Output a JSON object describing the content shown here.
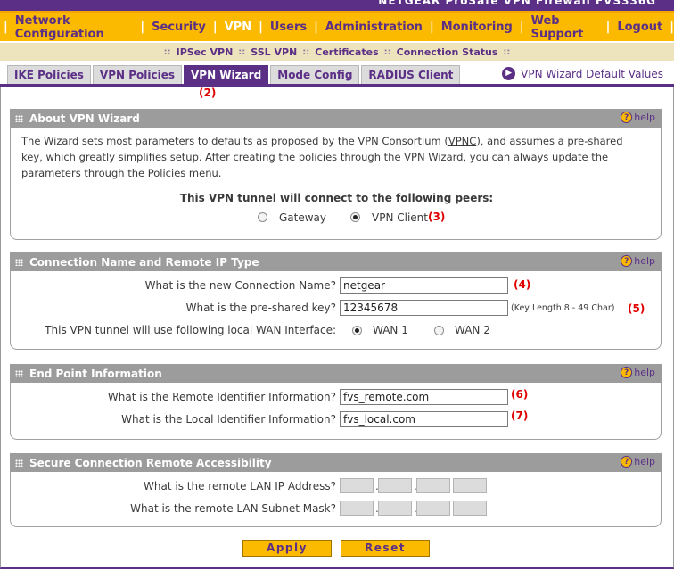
{
  "header": {
    "brand_fragment": "NETGEAR ProSafe VPN Firewall FVS336G"
  },
  "main_nav": {
    "items": [
      "Network Configuration",
      "Security",
      "VPN",
      "Users",
      "Administration",
      "Monitoring",
      "Web Support",
      "Logout"
    ],
    "active": "VPN"
  },
  "sub_nav": {
    "items": [
      "IPSec VPN",
      "SSL VPN",
      "Certificates",
      "Connection Status"
    ]
  },
  "tabs": {
    "items": [
      "IKE Policies",
      "VPN Policies",
      "VPN Wizard",
      "Mode Config",
      "RADIUS Client"
    ],
    "active": "VPN Wizard"
  },
  "defaults_link": {
    "label": "VPN Wizard Default Values"
  },
  "annotations": {
    "a2": "(2)",
    "a3": "(3)",
    "a4": "(4)",
    "a5": "(5)",
    "a6": "(6)",
    "a7": "(7)"
  },
  "help_label": "help",
  "about": {
    "title": "About VPN Wizard",
    "line1_pre": "The Wizard sets most parameters to defaults as proposed by the VPN Consortium (",
    "vpnc_link": "VPNC",
    "line1_post": "), and assumes a pre-shared",
    "line2": "key, which greatly simplifies setup. After creating the policies through the VPN Wizard, you can always update the",
    "line3_pre": "parameters through the ",
    "policies_link": "Policies",
    "line3_post": " menu.",
    "peers_question": "This VPN tunnel will connect to the following peers:",
    "peer_options": [
      "Gateway",
      "VPN Client"
    ],
    "peer_selected": "VPN Client"
  },
  "connection": {
    "title": "Connection Name and Remote IP Type",
    "name_label": "What is the new Connection Name?",
    "name_value": "netgear",
    "psk_label": "What is the pre-shared key?",
    "psk_value": "12345678",
    "psk_hint": "(Key Length 8 - 49 Char)",
    "wan_label": "This VPN tunnel will use following local WAN Interface:",
    "wan_options": [
      "WAN 1",
      "WAN 2"
    ],
    "wan_selected": "WAN 1"
  },
  "endpoint": {
    "title": "End Point Information",
    "remote_label": "What is the Remote Identifier Information?",
    "remote_value": "fvs_remote.com",
    "local_label": "What is the Local Identifier Information?",
    "local_value": "fvs_local.com"
  },
  "remote_access": {
    "title": "Secure Connection Remote Accessibility",
    "ip_label": "What is the remote LAN IP Address?",
    "mask_label": "What is the remote LAN Subnet Mask?"
  },
  "buttons": {
    "apply": "Apply",
    "reset": "Reset"
  },
  "colors": {
    "purple": "#5b2f86",
    "gold": "#fbb900",
    "annotation_red": "#e00000",
    "section_gray": "#9c9c9c"
  }
}
